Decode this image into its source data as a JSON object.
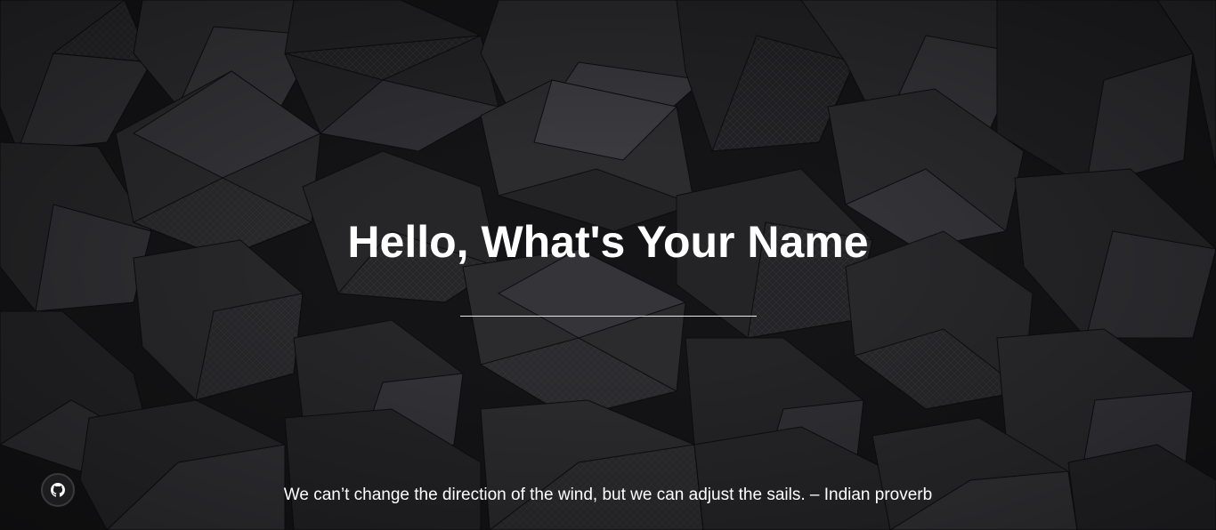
{
  "greeting": {
    "title": "Hello, What's Your Name"
  },
  "name_input": {
    "value": "",
    "placeholder": ""
  },
  "quote": {
    "text": "We can’t change the direction of the wind, but we can adjust the sails. – Indian proverb"
  },
  "links": {
    "github_icon": "github-icon"
  },
  "colors": {
    "background": "#121214",
    "text": "#ffffff",
    "input_underline": "#e8e8e8"
  }
}
